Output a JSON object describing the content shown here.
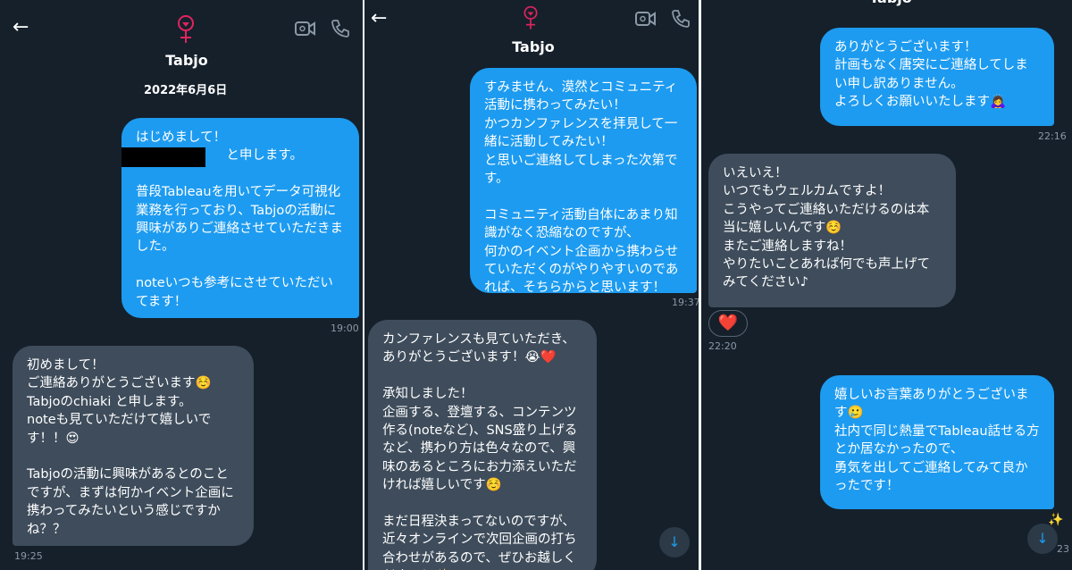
{
  "header": {
    "contact_name": "Tabjo",
    "date": "2022年6月6日"
  },
  "panel1": {
    "messages": [
      {
        "text": "はじめまして！\n                      と申します。\n\n普段Tableauを用いてデータ可視化業務を行っており、Tabjoの活動に興味がありご連絡させていただきました。\n\nnoteいつも参考にさせていただいてます！",
        "time": "19:00"
      },
      {
        "text": "初めまして！\nご連絡ありがとうございます☺️\nTabjoのchiaki と申します。\nnoteも見ていただけて嬉しいです！！😍\n\nTabjoの活動に興味があるとのことですが、まずは何かイベント企画に携わってみたいという感じですかね？？",
        "time": "19:25"
      }
    ]
  },
  "panel2": {
    "messages": [
      {
        "text": "すみません、漠然とコミュニティ活動に携わってみたい！\nかつカンファレンスを拝見して一緒に活動してみたい！\nと思いご連絡してしまった次第です。\n\nコミュニティ活動自体にあまり知識がなく恐縮なのですが、\n何かのイベント企画から携わらせていただくのがやりやすいのであれば、そちらからと思います！",
        "time": "19:37"
      },
      {
        "text": "カンファレンスも見ていただき、ありがとうございます！😭❤️\n\n承知しました！\n企画する、登壇する、コンテンツ作る(noteなど)、SNS盛り上げるなど、携わり方は色々なので、興味のあるところにお力添えいただければ嬉しいです☺️\n\nまだ日程決まってないのですが、近々オンラインで次回企画の打ち合わせがあるので、ぜひお越しください！✨"
      }
    ]
  },
  "panel3": {
    "messages": [
      {
        "text": "ありがとうございます！\n計画もなく唐突にご連絡してしまい申し訳ありません。\nよろしくお願いいたします🙇‍♀️",
        "time": "22:16"
      },
      {
        "text": "いえいえ！\nいつでもウェルカムですよ！\nこうやってご連絡いただけるのは本当に嬉しいんです☺️\nまたご連絡しますね！\nやりたいことあれば何でも声上げてみてください♪",
        "time": "22:20",
        "reaction": "❤️"
      },
      {
        "text": "嬉しいお言葉ありがとうございます🥲\n社内で同じ熱量でTableau話せる方とか居なかったので、\n勇気を出してご連絡してみて良かったです！",
        "time": "23"
      }
    ]
  },
  "icons": {
    "back": "←",
    "video": "video-call-icon",
    "phone": "phone-call-icon",
    "scroll_down": "↓",
    "star": "✨"
  },
  "colors": {
    "background": "#15202b",
    "outgoing": "#1d9bf0",
    "incoming": "#3e4c5b",
    "logo": "#e0245e"
  }
}
